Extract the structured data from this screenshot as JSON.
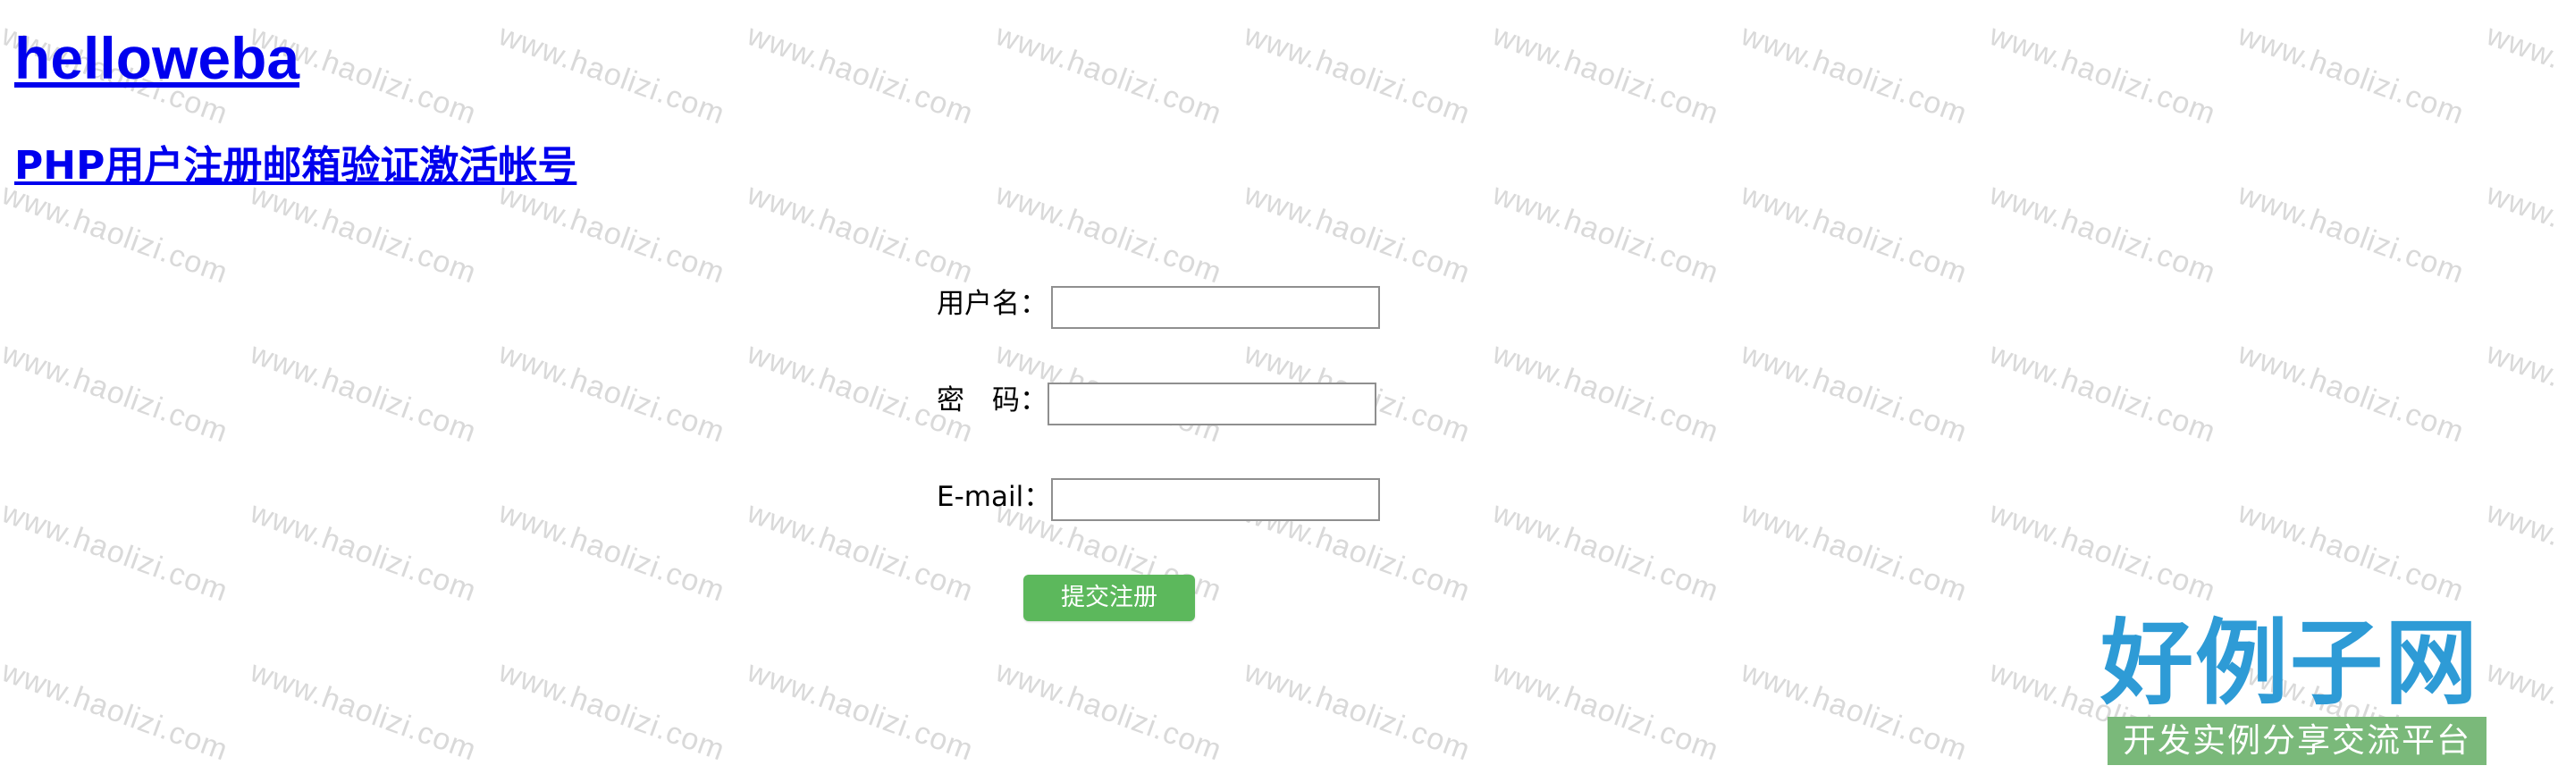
{
  "header": {
    "site_title": "helloweba",
    "article_title": "PHP用户注册邮箱验证激活帐号"
  },
  "form": {
    "username_label": "用户名：",
    "password_label": "密　码：",
    "email_label": "E-mail：",
    "username_value": "",
    "password_value": "",
    "email_value": "",
    "submit_label": "提交注册",
    "submit_color": "#5cb85c"
  },
  "watermark": {
    "text": "www.haolizi.com"
  },
  "logo": {
    "main_text": "好例子网",
    "sub_text": "开发实例分享交流平台",
    "main_color": "#2e9bd6",
    "sub_bg_color": "#7ab97a"
  }
}
